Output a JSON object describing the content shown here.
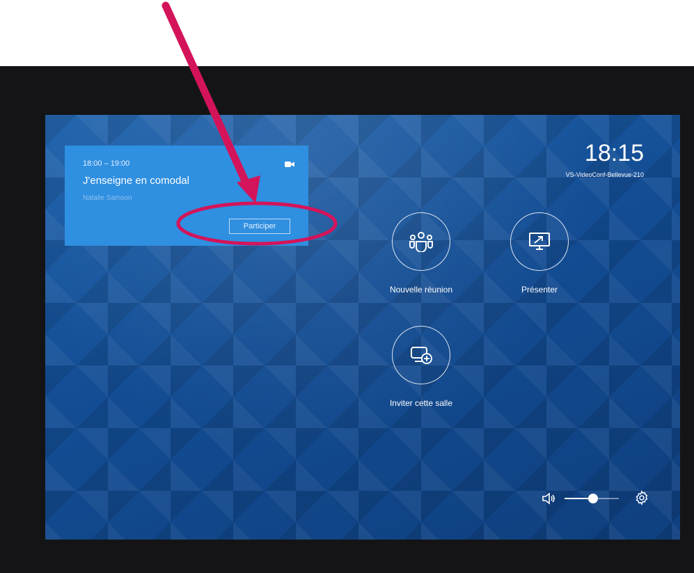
{
  "meeting": {
    "time": "18:00 – 19:00",
    "title": "J'enseigne en comodal",
    "organizer": "Natalie Samson",
    "join_label": "Participer",
    "icon": "video-camera-icon"
  },
  "header": {
    "clock": "18:15",
    "room_name": "VS-VideoConf-Bellevue-210"
  },
  "actions": [
    {
      "label": "Nouvelle réunion",
      "icon": "teams-group-icon"
    },
    {
      "label": "Présenter",
      "icon": "present-screen-icon"
    },
    {
      "label": "Inviter cette salle",
      "icon": "invite-room-icon"
    }
  ],
  "volume": {
    "level": 0.52,
    "icon": "speaker-icon"
  },
  "settings": {
    "icon": "gear-icon"
  },
  "annotation": {
    "color": "#d4145a",
    "shapes": [
      "arrow",
      "ellipse"
    ]
  },
  "colors": {
    "card": "#2f8fe0",
    "background": "#134d94",
    "accent_annotation": "#d4145a"
  }
}
